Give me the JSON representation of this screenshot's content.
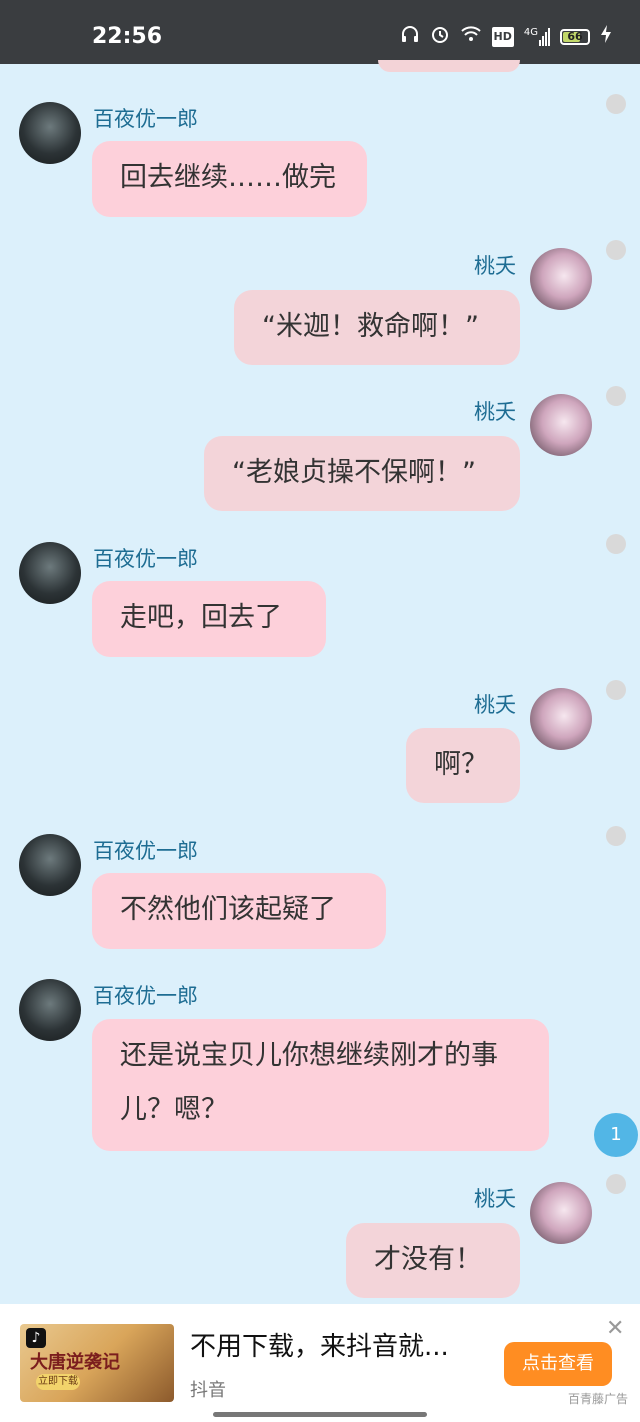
{
  "status_bar": {
    "time": "22:56",
    "hd_label": "HD",
    "network_label": "4G",
    "battery": "66"
  },
  "messages": [
    {
      "sender": "百夜优一郎",
      "text": "回去继续……做完"
    },
    {
      "sender": "桃夭",
      "text": "“米迦！救命啊！”"
    },
    {
      "sender": "桃夭",
      "text": "“老娘贞操不保啊！”"
    },
    {
      "sender": "百夜优一郎",
      "text": "走吧，回去了"
    },
    {
      "sender": "桃夭",
      "text": "啊？"
    },
    {
      "sender": "百夜优一郎",
      "text": "不然他们该起疑了"
    },
    {
      "sender": "百夜优一郎",
      "text": "还是说宝贝儿你想继续刚才的事儿？嗯？"
    },
    {
      "sender": "桃夭",
      "text": "才没有！"
    }
  ],
  "unread_badge": "1",
  "ad": {
    "thumbnail_title": "大唐逆袭记",
    "thumbnail_button": "立即下载",
    "headline": "不用下载，来抖音就...",
    "source": "抖音",
    "cta": "点击查看",
    "ad_label": "百青藤广告"
  }
}
